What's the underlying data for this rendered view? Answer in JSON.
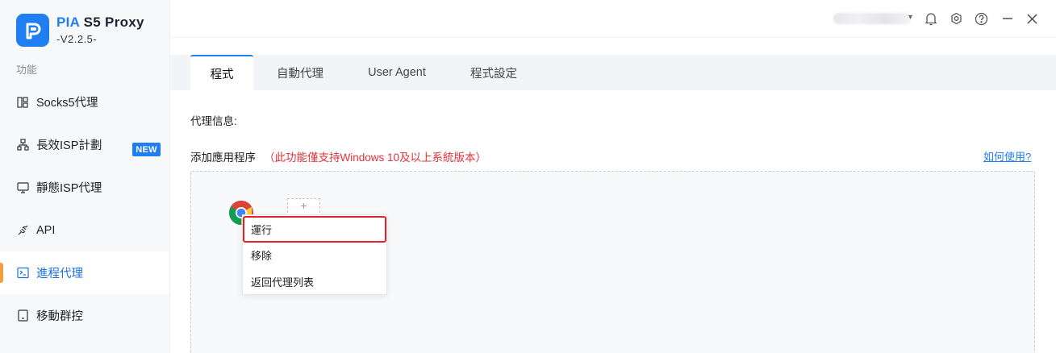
{
  "app": {
    "brand_pia": "PIA",
    "brand_rest": " S5 Proxy",
    "version": "-V2.2.5-"
  },
  "sidebar": {
    "section_label": "功能",
    "items": [
      {
        "label": "Socks5代理",
        "icon": "grid-icon"
      },
      {
        "label": "長效ISP計劃",
        "icon": "network-icon"
      },
      {
        "label": "靜態ISP代理",
        "icon": "monitor-icon"
      },
      {
        "label": "API",
        "icon": "plug-icon",
        "badge": "NEW"
      },
      {
        "label": "進程代理",
        "icon": "terminal-icon",
        "active": true
      },
      {
        "label": "移動群控",
        "icon": "tablet-icon"
      }
    ]
  },
  "topbar": {
    "icons": [
      "bell-icon",
      "settings-icon",
      "help-icon",
      "minimize-icon",
      "close-icon"
    ]
  },
  "tabs": [
    {
      "label": "程式",
      "active": true
    },
    {
      "label": "自動代理"
    },
    {
      "label": "User Agent"
    },
    {
      "label": "程式設定"
    }
  ],
  "content": {
    "proxy_info_label": "代理信息:",
    "add_app_label": "添加應用程序",
    "add_app_note": "（此功能僅支持Windows 10及以上系統版本）",
    "howto_link": "如何使用?",
    "add_slot_symbol": "+"
  },
  "context_menu": {
    "items": [
      "運行",
      "移除",
      "返回代理列表"
    ],
    "highlighted_index": 0
  },
  "colors": {
    "accent": "#1f7ef2",
    "warning_text": "#e0323a",
    "active_marker": "#f2a03b",
    "highlight_outline": "#e0232b"
  }
}
